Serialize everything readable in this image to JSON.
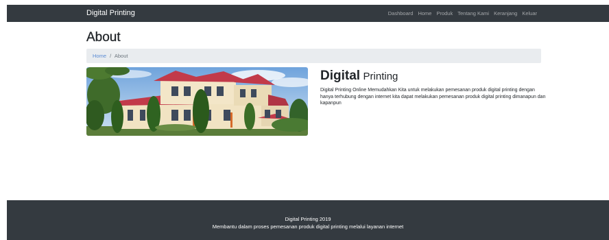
{
  "navbar": {
    "brand": "Digital Printing",
    "links": [
      "Dashboard",
      "Home",
      "Produk",
      "Tentang Kami",
      "Keranjang",
      "Keluar"
    ]
  },
  "page": {
    "title": "About"
  },
  "breadcrumb": {
    "home": "Home",
    "separator": "/",
    "current": "About"
  },
  "about": {
    "heading_bold": "Digital",
    "heading_light": "Printing",
    "description": "Digital Printing Online Memudahkan Kita untuk melakukan pemesanan produk digital printing dengan hanya terhubung dengan internet kita dapat melakukan pemesanan produk digital printing dimanapun dan kapanpun"
  },
  "footer": {
    "title": "Digital Printing 2019",
    "subtitle": "Membantu dalam proses pemesanan produk digital printing melalui layanan internet"
  },
  "colors": {
    "navbar_bg": "#343a40",
    "breadcrumb_bg": "#e9ecef",
    "link": "#5a8bd4",
    "footer_bg": "#343a40"
  }
}
